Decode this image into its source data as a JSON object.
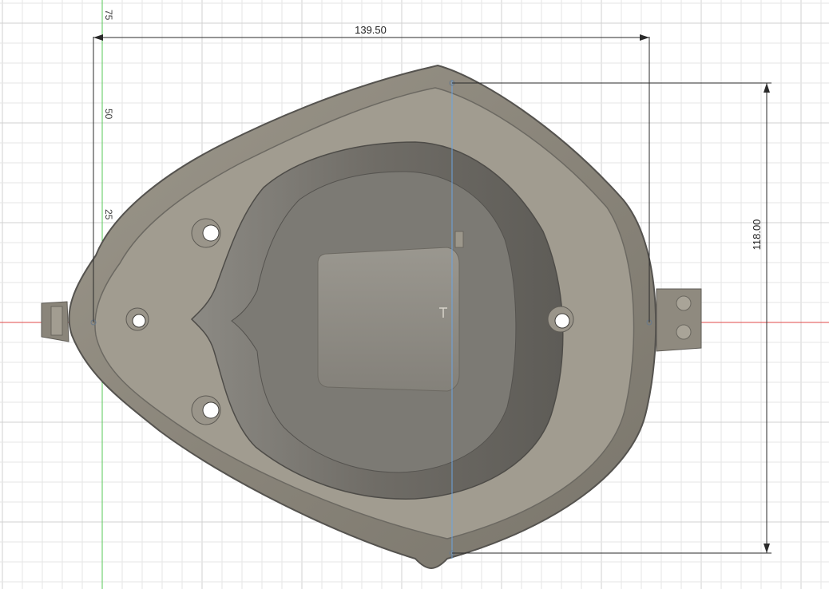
{
  "viewport": {
    "grid_minor_color": "#e6e6e6",
    "grid_major_color": "#d0d0d0",
    "x_axis_color": "#e04848",
    "y_axis_green_color": "#5ac85a",
    "y_axis_blue_color": "#6ca4e0"
  },
  "dimensions": {
    "width_label": "139.50",
    "height_label": "118.00"
  },
  "ruler": {
    "marks": [
      "75",
      "50",
      "25"
    ]
  },
  "part": {
    "body_color": "#8a857a",
    "rim_color": "#a49f93",
    "cavity_color": "#6f6c66",
    "shadow_color": "#55534f"
  }
}
